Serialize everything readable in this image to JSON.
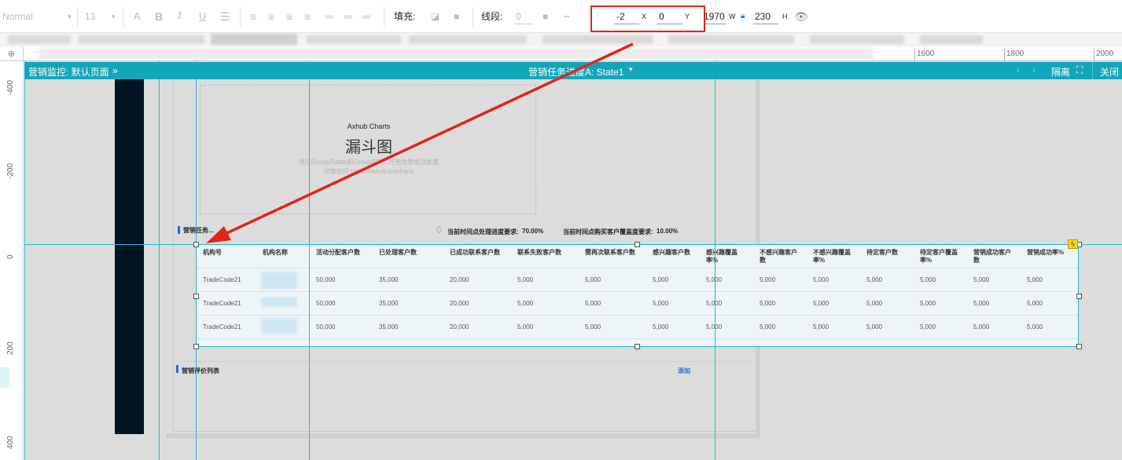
{
  "toolbar": {
    "font_family": "Normal",
    "font_size": "13",
    "fill_label": "填充:",
    "stroke_label": "线段:",
    "stroke_value": "0",
    "x_value": "-2",
    "x_label": "X",
    "y_value": "0",
    "y_label": "Y",
    "w_value": "1970",
    "w_label": "W",
    "h_value": "230",
    "h_label": "H"
  },
  "ruler": {
    "h_ticks": [
      "1600",
      "1800",
      "2000"
    ],
    "v_ticks": [
      "-400",
      "-200",
      "0",
      "200",
      "400"
    ]
  },
  "modal": {
    "title": "营销监控: 默认页面",
    "title_chevron": "»",
    "center_title": "营销任务进度A: State1",
    "isolate_label": "隔离",
    "close_label": "关闭"
  },
  "chart_placeholder": {
    "brand": "Axhub Charts",
    "title": "漏斗图",
    "desc1": "通过Group内data和Group内的...可更改数据及配置",
    "desc2": "详情访问 https://axhub.im/charts"
  },
  "section1": {
    "title": "营销任务...",
    "req1_label": "当前时间点处理进度要求:",
    "req1_value": "70.00%",
    "req2_label": "当前时间点购买客户覆盖度要求:",
    "req2_value": "10.00%"
  },
  "table": {
    "headers": [
      "机构号",
      "机构名称",
      "活动分配客户数",
      "已处理客户数",
      "已成功联系客户数",
      "联系失败客户数",
      "需再次联系客户数",
      "感兴趣客户数",
      "感兴趣覆盖率%",
      "不感兴趣客户数",
      "不感兴趣覆盖率%",
      "待定客户数",
      "待定客户覆盖率%",
      "营销成功客户数",
      "营销成功率%"
    ],
    "rows": [
      [
        "TradeCode21",
        "",
        "50,000",
        "35,000",
        "20,000",
        "5,000",
        "5,000",
        "5,000",
        "5,000",
        "5,000",
        "5,000",
        "5,000",
        "5,000",
        "5,000",
        "5,000"
      ],
      [
        "TradeCode21",
        "",
        "50,000",
        "35,000",
        "20,000",
        "5,000",
        "5,000",
        "5,000",
        "5,000",
        "5,000",
        "5,000",
        "5,000",
        "5,000",
        "5,000",
        "5,000"
      ],
      [
        "TradeCode21",
        "",
        "50,000",
        "35,000",
        "20,000",
        "5,000",
        "5,000",
        "5,000",
        "5,000",
        "5,000",
        "5,000",
        "5,000",
        "5,000",
        "5,000",
        "5,000"
      ]
    ]
  },
  "section2": {
    "title": "营销评价列表",
    "add_label": "添加"
  },
  "colors": {
    "accent": "#13a6bb",
    "guide": "#1bbccf",
    "annotation": "#e52317",
    "sidebar": "#021322"
  }
}
